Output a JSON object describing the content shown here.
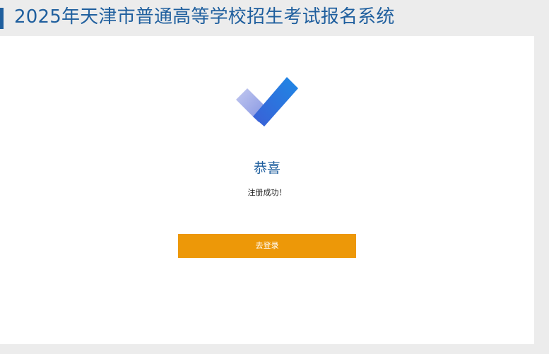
{
  "header": {
    "title": "2025年天津市普通高等学校招生考试报名系统"
  },
  "result": {
    "icon": "check-mark-icon",
    "heading": "恭喜",
    "message": "注册成功！"
  },
  "actions": {
    "login_label": "去登录"
  },
  "colors": {
    "accent": "#1f5f9e",
    "button": "#ed9808",
    "background": "#ececec",
    "check_light": "#a9b4ea",
    "check_dark": "#1e7be0"
  }
}
